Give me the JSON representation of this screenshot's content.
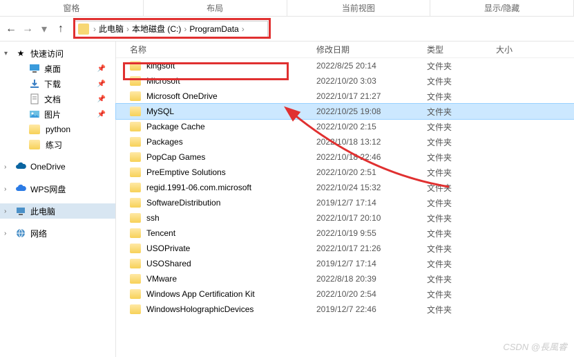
{
  "ribbon": [
    "窗格",
    "布局",
    "当前视图",
    "显示/隐藏"
  ],
  "breadcrumb": [
    "此电脑",
    "本地磁盘 (C:)",
    "ProgramData"
  ],
  "columns": {
    "name": "名称",
    "date": "修改日期",
    "type": "类型",
    "size": "大小"
  },
  "sidebar": {
    "quick": "快速访问",
    "desktop": "桌面",
    "downloads": "下载",
    "documents": "文档",
    "pictures": "图片",
    "python": "python",
    "practice": "练习",
    "onedrive": "OneDrive",
    "wps": "WPS网盘",
    "thispc": "此电脑",
    "network": "网络"
  },
  "type_folder": "文件夹",
  "rows": [
    {
      "name": "kingsoft",
      "date": "2022/8/25 20:14"
    },
    {
      "name": "Microsoft",
      "date": "2022/10/20 3:03"
    },
    {
      "name": "Microsoft OneDrive",
      "date": "2022/10/17 21:27"
    },
    {
      "name": "MySQL",
      "date": "2022/10/25 19:08",
      "selected": true
    },
    {
      "name": "Package Cache",
      "date": "2022/10/20 2:15"
    },
    {
      "name": "Packages",
      "date": "2022/10/18 13:12"
    },
    {
      "name": "PopCap Games",
      "date": "2022/10/18 22:46"
    },
    {
      "name": "PreEmptive Solutions",
      "date": "2022/10/20 2:51"
    },
    {
      "name": "regid.1991-06.com.microsoft",
      "date": "2022/10/24 15:32"
    },
    {
      "name": "SoftwareDistribution",
      "date": "2019/12/7 17:14"
    },
    {
      "name": "ssh",
      "date": "2022/10/17 20:10"
    },
    {
      "name": "Tencent",
      "date": "2022/10/19 9:55"
    },
    {
      "name": "USOPrivate",
      "date": "2022/10/17 21:26"
    },
    {
      "name": "USOShared",
      "date": "2019/12/7 17:14"
    },
    {
      "name": "VMware",
      "date": "2022/8/18 20:39"
    },
    {
      "name": "Windows App Certification Kit",
      "date": "2022/10/20 2:54"
    },
    {
      "name": "WindowsHolographicDevices",
      "date": "2019/12/7 22:46"
    }
  ],
  "watermark": "CSDN @長風睿",
  "highlight_color": "#e03030"
}
